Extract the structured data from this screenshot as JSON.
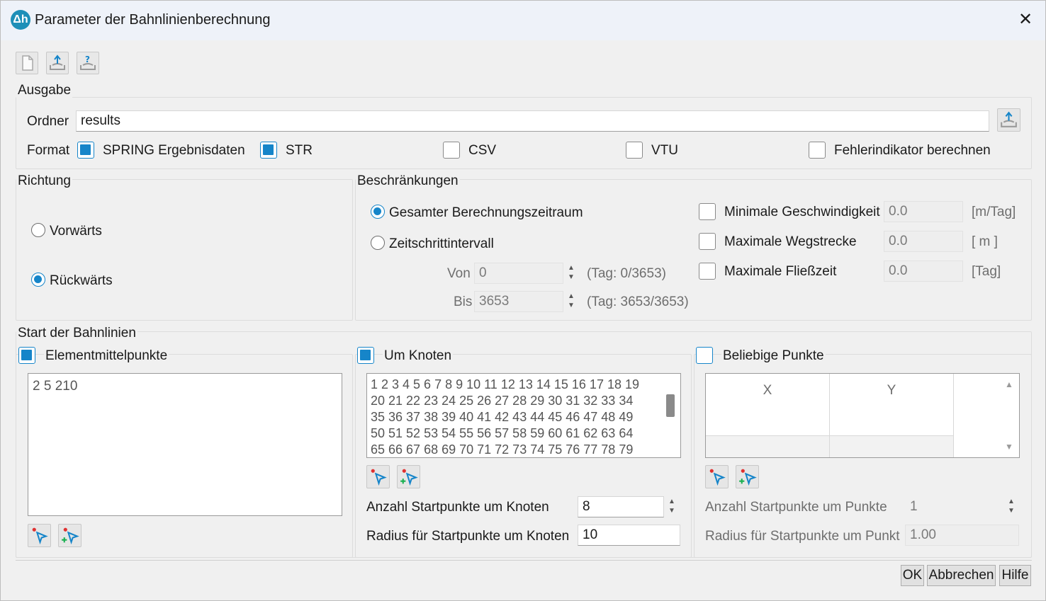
{
  "window": {
    "title": "Parameter der Bahnlinienberechnung"
  },
  "toolbar": {
    "new": "new-file-icon",
    "export": "export-icon",
    "help": "help-export-icon"
  },
  "ausgabe": {
    "title": "Ausgabe",
    "ordner_label": "Ordner",
    "ordner_value": "results",
    "format_label": "Format",
    "formats": [
      {
        "label": "SPRING Ergebnisdaten",
        "checked": true
      },
      {
        "label": "STR",
        "checked": true
      },
      {
        "label": "CSV",
        "checked": false
      },
      {
        "label": "VTU",
        "checked": false
      },
      {
        "label": "Fehlerindikator berechnen",
        "checked": false
      }
    ]
  },
  "richtung": {
    "title": "Richtung",
    "vorwaerts": "Vorwärts",
    "rueckwaerts": "Rückwärts",
    "selected": "Rückwärts"
  },
  "beschraenkungen": {
    "title": "Beschränkungen",
    "gesamt": "Gesamter Berechnungszeitraum",
    "intervall": "Zeitschrittintervall",
    "von_label": "Von",
    "von_value": "0",
    "von_info": "(Tag: 0/3653)",
    "bis_label": "Bis",
    "bis_value": "3653",
    "bis_info": "(Tag: 3653/3653)",
    "limits": [
      {
        "label": "Minimale Geschwindigkeit",
        "value": "0.0",
        "unit": "[m/Tag]"
      },
      {
        "label": "Maximale Wegstrecke",
        "value": "0.0",
        "unit": "[ m ]"
      },
      {
        "label": "Maximale Fließzeit",
        "value": "0.0",
        "unit": "[Tag]"
      }
    ]
  },
  "start": {
    "title": "Start der Bahnlinien",
    "element": {
      "label": "Elementmittelpunkte",
      "checked": true,
      "text": "2 5 210"
    },
    "knoten": {
      "label": "Um Knoten",
      "checked": true,
      "lines": [
        "1 2 3 4 5 6 7 8 9 10 11 12 13 14 15 16 17 18 19",
        "20 21 22 23 24 25 26 27 28 29 30 31 32 33 34",
        "35 36 37 38 39 40 41 42 43 44 45 46 47 48 49",
        "50 51 52 53 54 55 56 57 58 59 60 61 62 63 64",
        "65 66 67 68 69 70 71 72 73 74 75 76 77 78 79"
      ],
      "anzahl_label": "Anzahl Startpunkte um Knoten",
      "anzahl_value": "8",
      "radius_label": "Radius für Startpunkte um Knoten",
      "radius_value": "10"
    },
    "punkte": {
      "label": "Beliebige Punkte",
      "checked": false,
      "col_x": "X",
      "col_y": "Y",
      "anzahl_label": "Anzahl Startpunkte um Punkte",
      "anzahl_value": "1",
      "radius_label": "Radius für Startpunkte um Punkt",
      "radius_value": "1.00"
    }
  },
  "buttons": {
    "ok": "OK",
    "cancel": "Abbrechen",
    "help": "Hilfe"
  },
  "colors": {
    "accent": "#1685c9",
    "titlebar": "#eef2f9"
  }
}
